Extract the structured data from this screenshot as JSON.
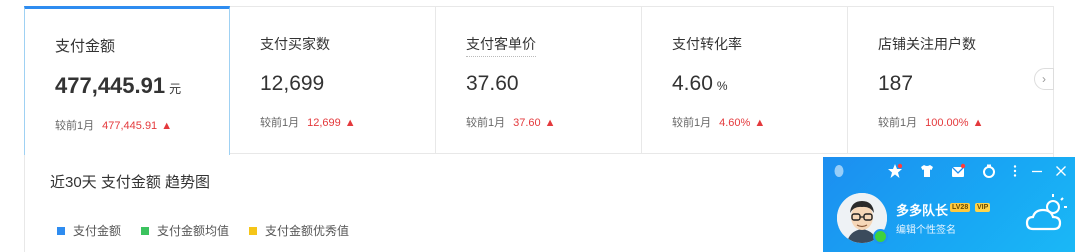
{
  "metrics": [
    {
      "label": "支付金额",
      "value": "477,445.91",
      "unit": "元",
      "compare_label": "较前1月",
      "compare_value": "477,445.91",
      "trend": "up"
    },
    {
      "label": "支付买家数",
      "value": "12,699",
      "unit": "",
      "compare_label": "较前1月",
      "compare_value": "12,699",
      "trend": "up"
    },
    {
      "label": "支付客单价",
      "value": "37.60",
      "unit": "",
      "compare_label": "较前1月",
      "compare_value": "37.60",
      "trend": "up"
    },
    {
      "label": "支付转化率",
      "value": "4.60",
      "unit": "%",
      "compare_label": "较前1月",
      "compare_value": "4.60%",
      "trend": "up"
    },
    {
      "label": "店铺关注用户数",
      "value": "187",
      "unit": "",
      "compare_label": "较前1月",
      "compare_value": "100.00%",
      "trend": "up"
    }
  ],
  "arrow_glyph": "🡅",
  "trend_title": "近30天 支付金额 趋势图",
  "legend": [
    {
      "label": "支付金额",
      "color": "#2e8cf0"
    },
    {
      "label": "支付金额均值",
      "color": "#3cc35f"
    },
    {
      "label": "支付金额优秀值",
      "color": "#f5c518"
    }
  ],
  "colors": {
    "accent": "#2e8cf0",
    "up": "#e4393c",
    "qq_blue": "#1c8ef0"
  },
  "qq": {
    "nickname": "多多队长",
    "level_badge": "LV28",
    "vip_badge": "VIP",
    "signature": "编辑个性签名",
    "icons": [
      "qq-penguin-icon",
      "star-icon",
      "shirt-icon",
      "mail-icon",
      "badge-icon",
      "more-icon",
      "minimize-icon",
      "close-icon"
    ]
  }
}
